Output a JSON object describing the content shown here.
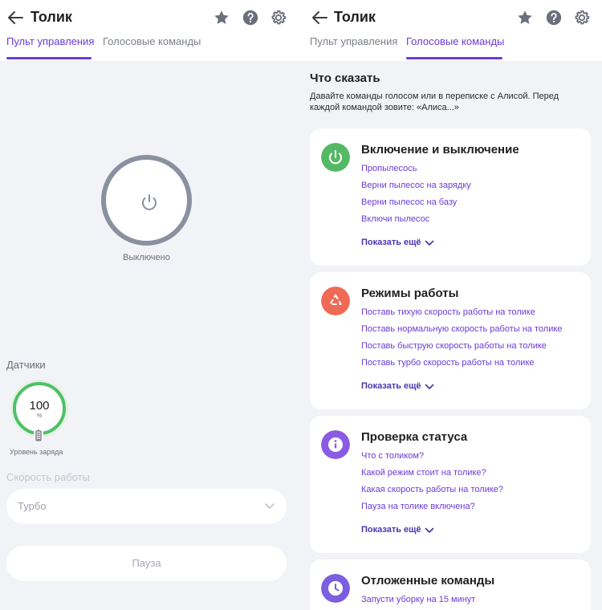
{
  "left": {
    "header": {
      "title": "Толик"
    },
    "tabs": [
      {
        "label": "Пульт управления"
      },
      {
        "label": "Голосовые команды"
      }
    ],
    "power": {
      "status": "Выключено"
    },
    "sensors": {
      "title": "Датчики",
      "battery_value": "100",
      "battery_unit": "%",
      "battery_label": "Уровень заряда",
      "battery_level_percent": 100
    },
    "speed": {
      "title": "Скорость работы",
      "value": "Турбо"
    },
    "pause_label": "Пауза"
  },
  "right": {
    "header": {
      "title": "Толик"
    },
    "tabs": [
      {
        "label": "Пульт управления"
      },
      {
        "label": "Голосовые команды"
      }
    ],
    "intro": {
      "title": "Что сказать",
      "description": "Давайте команды голосом или в переписке с Алисой. Перед каждой командой зовите: «Алиса...»"
    },
    "cards": [
      {
        "title": "Включение и выключение",
        "icon": "power-icon",
        "color": "#55b865",
        "commands": [
          "Пропылесось",
          "Верни пылесос на зарядку",
          "Верни пылесос на базу",
          "Включи пылесос"
        ],
        "more": "Показать ещё"
      },
      {
        "title": "Режимы работы",
        "icon": "modes-icon",
        "color": "#ef6a55",
        "commands": [
          "Поставь тихую скорость работы на толике",
          "Поставь нормальную скорость работы на толике",
          "Поставь быструю скорость работы на толике",
          "Поставь турбо скорость работы на толике"
        ],
        "more": "Показать ещё"
      },
      {
        "title": "Проверка статуса",
        "icon": "info-icon",
        "color": "#8a5ce6",
        "commands": [
          "Что с толиком?",
          "Какой режим стоит на толике?",
          "Какая скорость работы на толике?",
          "Пауза на толике включена?"
        ],
        "more": "Показать ещё"
      },
      {
        "title": "Отложенные команды",
        "icon": "clock-icon",
        "color": "#7b5fe0",
        "commands": [
          "Запусти уборку на 15 минут"
        ],
        "more": ""
      }
    ]
  },
  "colors": {
    "accent": "#6a3bd8",
    "power_ring": "#8b90a1",
    "battery": "#4fc066"
  }
}
